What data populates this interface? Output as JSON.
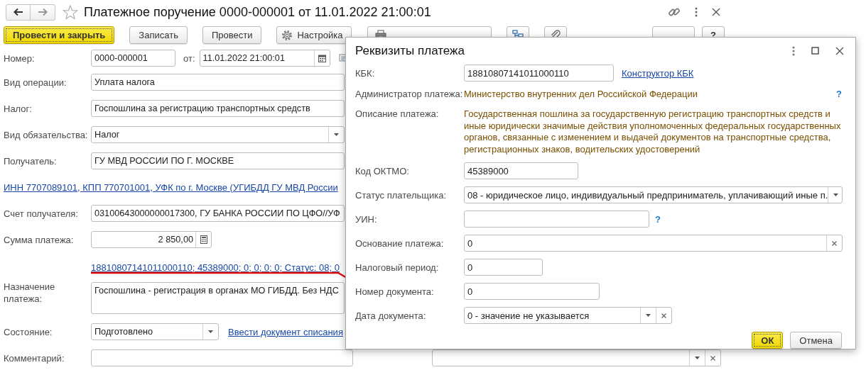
{
  "window": {
    "title": "Платежное поручение 0000-000001 от 11.01.2022 21:00:01"
  },
  "toolbar": {
    "buttons": [
      {
        "kind": "primary",
        "label": "Провести и закрыть"
      },
      {
        "kind": "plain",
        "label": "Записать"
      },
      {
        "kind": "plain",
        "label": "Провести"
      },
      {
        "kind": "settings",
        "label": "Настройка"
      },
      {
        "kind": "print"
      },
      {
        "kind": "structure"
      },
      {
        "kind": "attach"
      },
      {
        "kind": "more"
      },
      {
        "kind": "plain",
        "label": "?"
      }
    ]
  },
  "form": {
    "number": {
      "label": "Номер:",
      "value": "0000-000001"
    },
    "date": {
      "label": "от:",
      "value": "11.01.2022 21:00:01"
    },
    "rows": [
      {
        "kind": "text",
        "label": "Вид операции:",
        "value": "Уплата налога"
      },
      {
        "kind": "text",
        "label": "Налог:",
        "value": "Госпошлина за регистрацию транспортных средств"
      },
      {
        "kind": "select",
        "label": "Вид обязательства:",
        "value": "Налог"
      },
      {
        "kind": "text",
        "label": "Получатель:",
        "value": "ГУ МВД РОССИИ ПО Г. МОСКВЕ"
      },
      {
        "kind": "link",
        "value": "ИНН 7707089101, КПП 770701001, УФК по г. Москве (УГИБДД ГУ МВД России"
      },
      {
        "kind": "text",
        "label": "Счет получателя:",
        "value": "03100643000000017300, ГУ БАНКА РОССИИ ПО ЦФО//УФ"
      },
      {
        "kind": "amount",
        "label": "Сумма платежа:",
        "value": "2 850,00"
      },
      {
        "kind": "details",
        "value": "18810807141011000110; 45389000; 0; 0; 0; 0; Статус: 08; 0"
      },
      {
        "kind": "memo",
        "label": "Назначение платежа:",
        "value": "Госпошлина - регистрация в органах МО ГИБДД. Без НДС"
      },
      {
        "kind": "status",
        "label": "Состояние:",
        "value": "Подготовлено",
        "link": "Ввести документ списания"
      },
      {
        "kind": "comment",
        "label": "Комментарий:"
      }
    ]
  },
  "dialog": {
    "title": "Реквизиты платежа",
    "rows": [
      {
        "kind": "field",
        "label": "КБК:",
        "value": "18810807141011000110",
        "link": "Конструктор КБК"
      },
      {
        "kind": "info",
        "label": "Администратор платежа:",
        "value": "Министерство внутренних дел Российской Федерации",
        "help": "?"
      },
      {
        "kind": "info",
        "label": "Описание платежа:",
        "value": "Государственная пошлина за государственную регистрацию транспортных средств и иные юридически значимые действия уполномоченных федеральных государственных органов, связанные с изменением и выдачей документов на транспортные средства, регистрационных знаков, водительских удостоверений"
      },
      {
        "kind": "field",
        "label": "Код ОКТМО:",
        "value": "45389000"
      },
      {
        "kind": "select",
        "label": "Статус плательщика:",
        "value": "08 - юридическое лицо, индивидуальный предприниматель, уплачивающий иные п."
      },
      {
        "kind": "field",
        "label": "УИН:",
        "help": "?"
      },
      {
        "kind": "clearable",
        "label": "Основание платежа:",
        "value": "0"
      },
      {
        "kind": "field",
        "label": "Налоговый период:",
        "value": "0"
      },
      {
        "kind": "field",
        "label": "Номер документа:",
        "value": "0"
      },
      {
        "kind": "select-clearable",
        "label": "Дата документа:",
        "value": "0 - значение не указывается"
      }
    ],
    "buttons": [
      {
        "kind": "primary",
        "label": "ОК"
      },
      {
        "kind": "plain",
        "label": "Отмена"
      }
    ]
  }
}
